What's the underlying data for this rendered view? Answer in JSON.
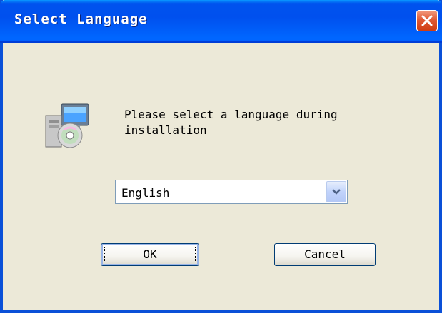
{
  "window": {
    "title": "Select Language"
  },
  "dialog": {
    "prompt": "Please select a language during\ninstallation",
    "language_select": {
      "selected": "English"
    },
    "ok_label": "OK",
    "cancel_label": "Cancel"
  },
  "icons": {
    "close": "close-icon",
    "installer": "installer-icon",
    "dropdown": "chevron-down-icon"
  },
  "colors": {
    "titlebar": "#0050ee",
    "close_button": "#e05a34",
    "dialog_background": "#ece9d8",
    "button_border": "#003c74"
  }
}
